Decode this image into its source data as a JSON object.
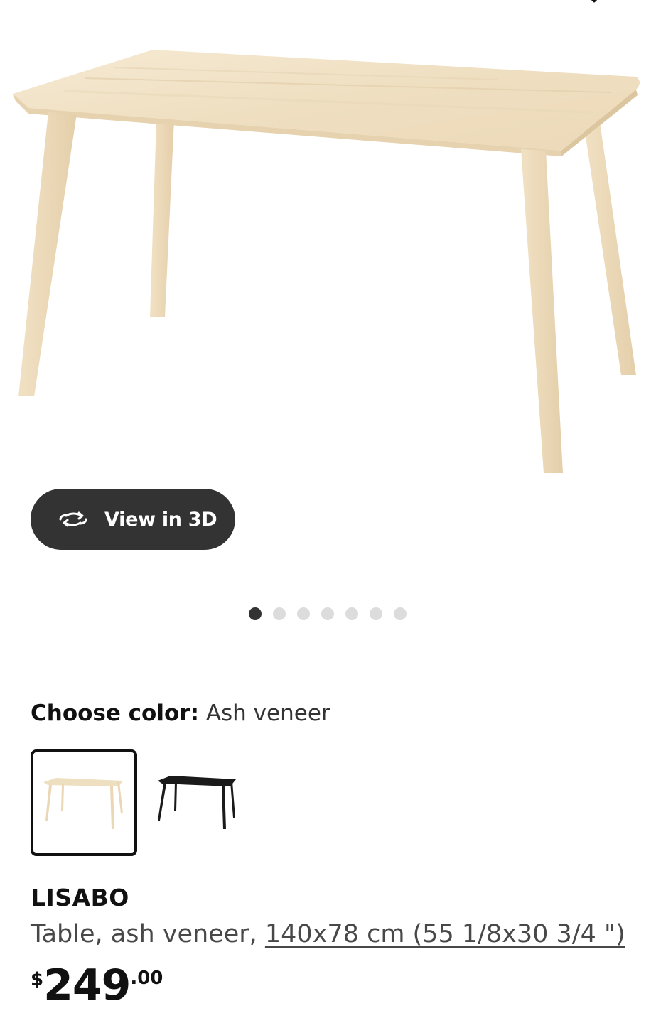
{
  "product": {
    "view3d_label": "View in 3D",
    "carousel": {
      "count": 7,
      "active_index": 0
    },
    "color": {
      "label": "Choose color:",
      "value": "Ash veneer",
      "options": [
        "Ash veneer",
        "Black"
      ]
    },
    "name": "LISABO",
    "description_prefix": "Table, ash veneer, ",
    "dimensions": "140x78 cm (55 1/8x30 3/4 \")",
    "price": {
      "currency": "$",
      "integer": "249",
      "decimal": ".00"
    }
  },
  "colors": {
    "pill_bg": "#333333",
    "dot_active": "#333333",
    "dot_inactive": "#dcdcdc",
    "wood": "#f0dfc2"
  },
  "icons": [
    "heart-icon",
    "rotate-3d-icon"
  ]
}
